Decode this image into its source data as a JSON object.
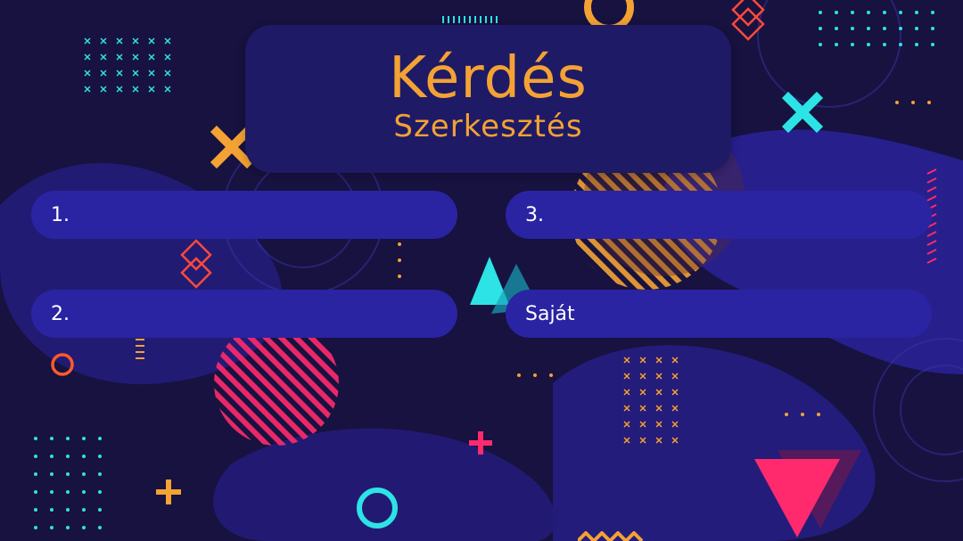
{
  "title": {
    "main": "Kérdés",
    "sub": "Szerkesztés"
  },
  "answers": [
    {
      "label": "1."
    },
    {
      "label": "2."
    },
    {
      "label": "3."
    },
    {
      "label": "Saját"
    }
  ],
  "colors": {
    "background": "#17123f",
    "card": "#1e1a66",
    "button": "#2a24a3",
    "accent_orange": "#f3a233",
    "accent_cyan": "#2de3e6",
    "accent_pink": "#ff2a6d"
  },
  "decorations": [
    "x-mark-icon",
    "circle-ring-icon",
    "plus-icon",
    "triangle-icon",
    "diamond-icon",
    "dot-grid"
  ]
}
